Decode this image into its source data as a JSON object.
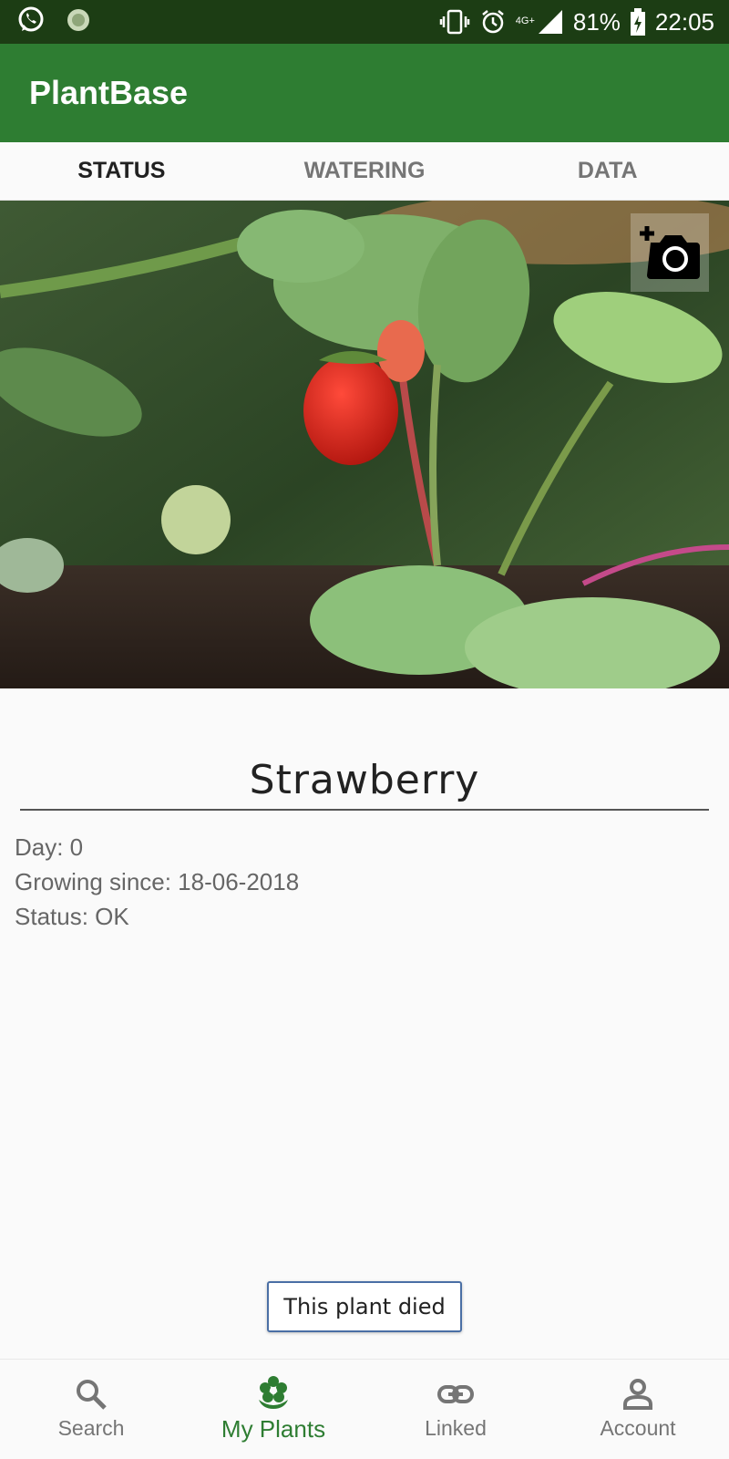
{
  "status_bar": {
    "battery": "81%",
    "time": "22:05",
    "network": "4G+",
    "icons": [
      "whatsapp-icon",
      "notification-icon",
      "vibrate-icon",
      "alarm-icon",
      "signal-icon",
      "battery-charging-icon"
    ]
  },
  "app_bar": {
    "title": "PlantBase"
  },
  "tabs": [
    {
      "label": "STATUS",
      "active": true
    },
    {
      "label": "WATERING",
      "active": false
    },
    {
      "label": "DATA",
      "active": false
    }
  ],
  "photo": {
    "camera_icon": "add-photo-icon"
  },
  "plant": {
    "name": "Strawberry",
    "day": "Day: 0",
    "growing_since": "Growing since: 18-06-2018",
    "status": "Status: OK"
  },
  "actions": {
    "died_label": "This plant died"
  },
  "bottom_nav": [
    {
      "label": "Search",
      "icon": "search-icon",
      "active": false
    },
    {
      "label": "My Plants",
      "icon": "flower-icon",
      "active": true
    },
    {
      "label": "Linked",
      "icon": "link-icon",
      "active": false
    },
    {
      "label": "Account",
      "icon": "account-icon",
      "active": false
    }
  ],
  "colors": {
    "primary": "#2e7d32",
    "status_bar": "#1c3d14",
    "accent_border": "#4a6fa5"
  }
}
